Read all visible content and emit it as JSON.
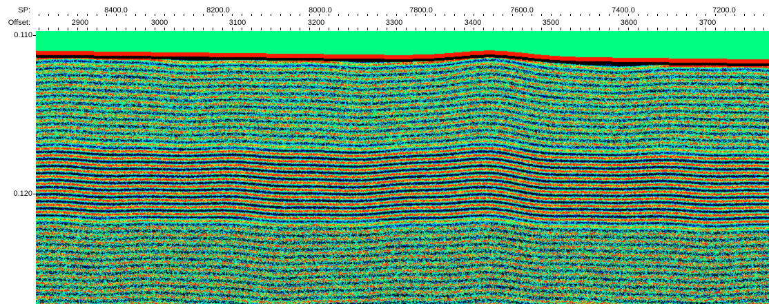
{
  "header": {
    "sp_label": "SP:",
    "offset_label": "Offset:",
    "sp_ticks": [
      "8400.0",
      "8200.0",
      "8000.0",
      "7800.0",
      "7600.0",
      "7400.0",
      "7200.0"
    ],
    "offset_ticks": [
      "2900",
      "3000",
      "3100",
      "3200",
      "3300",
      "3400",
      "3500",
      "3600",
      "3700"
    ]
  },
  "time_axis": {
    "labels": [
      "0.110",
      "0.120"
    ]
  },
  "colors": {
    "sea": "#00ff80",
    "peak": "#ff1a00",
    "trough": "#000000",
    "noise_a": "#00e6ff",
    "noise_b": "#0020c8",
    "noise_c": "#ffd21e"
  }
}
